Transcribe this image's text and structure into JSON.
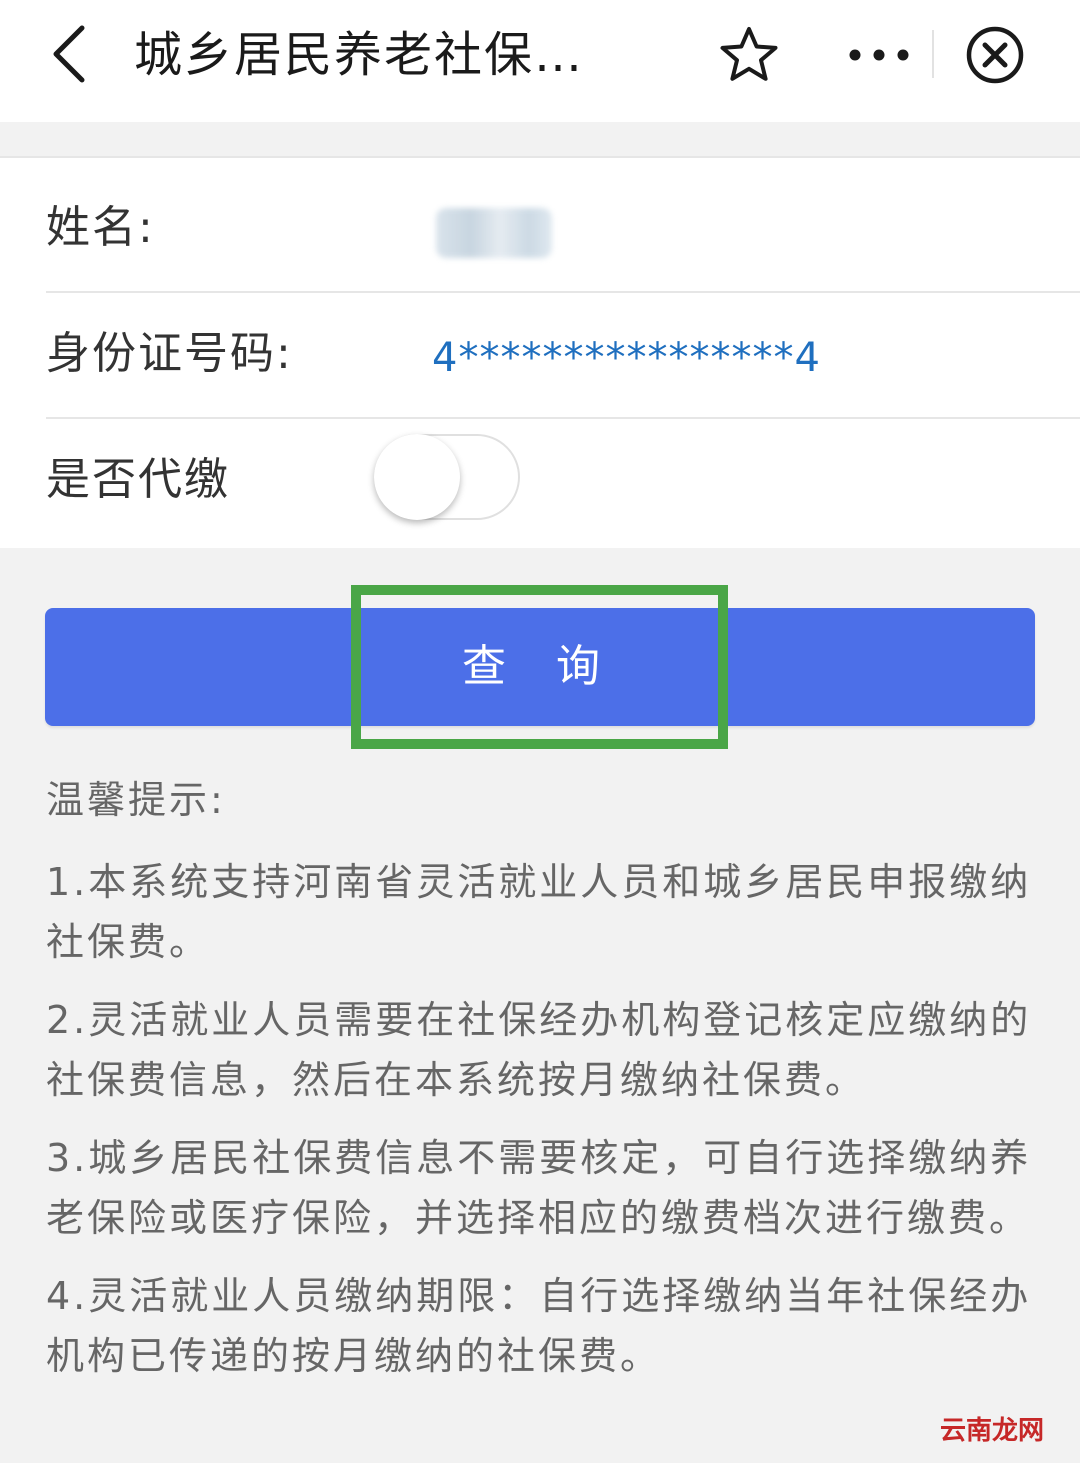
{
  "navbar": {
    "title": "城乡居民养老社保…",
    "icons": [
      "back-chevron-icon",
      "star-icon",
      "more-dots-icon",
      "close-circle-icon"
    ]
  },
  "form": {
    "name_label": "姓名:",
    "id_label": "身份证号码:",
    "id_value": "4****************4",
    "proxy_label": "是否代缴",
    "proxy_on": false
  },
  "query_button": {
    "label": "查 询"
  },
  "tips": {
    "title": "温馨提示:",
    "items": [
      "1.本系统支持河南省灵活就业人员和城乡居民申报缴纳社保费。",
      "2.灵活就业人员需要在社保经办机构登记核定应缴纳的社保费信息，然后在本系统按月缴纳社保费。",
      "3.城乡居民社保费信息不需要核定，可自行选择缴纳养老保险或医疗保险，并选择相应的缴费档次进行缴费。",
      "4.灵活就业人员缴纳期限：自行选择缴纳当年社保经办机构已传递的按月缴纳的社保费。"
    ]
  },
  "watermark": "云南龙网",
  "colors": {
    "primary_button": "#4c6fe8",
    "highlight_box": "#4aa647",
    "id_text": "#1f6fbf",
    "watermark": "#c62828"
  }
}
